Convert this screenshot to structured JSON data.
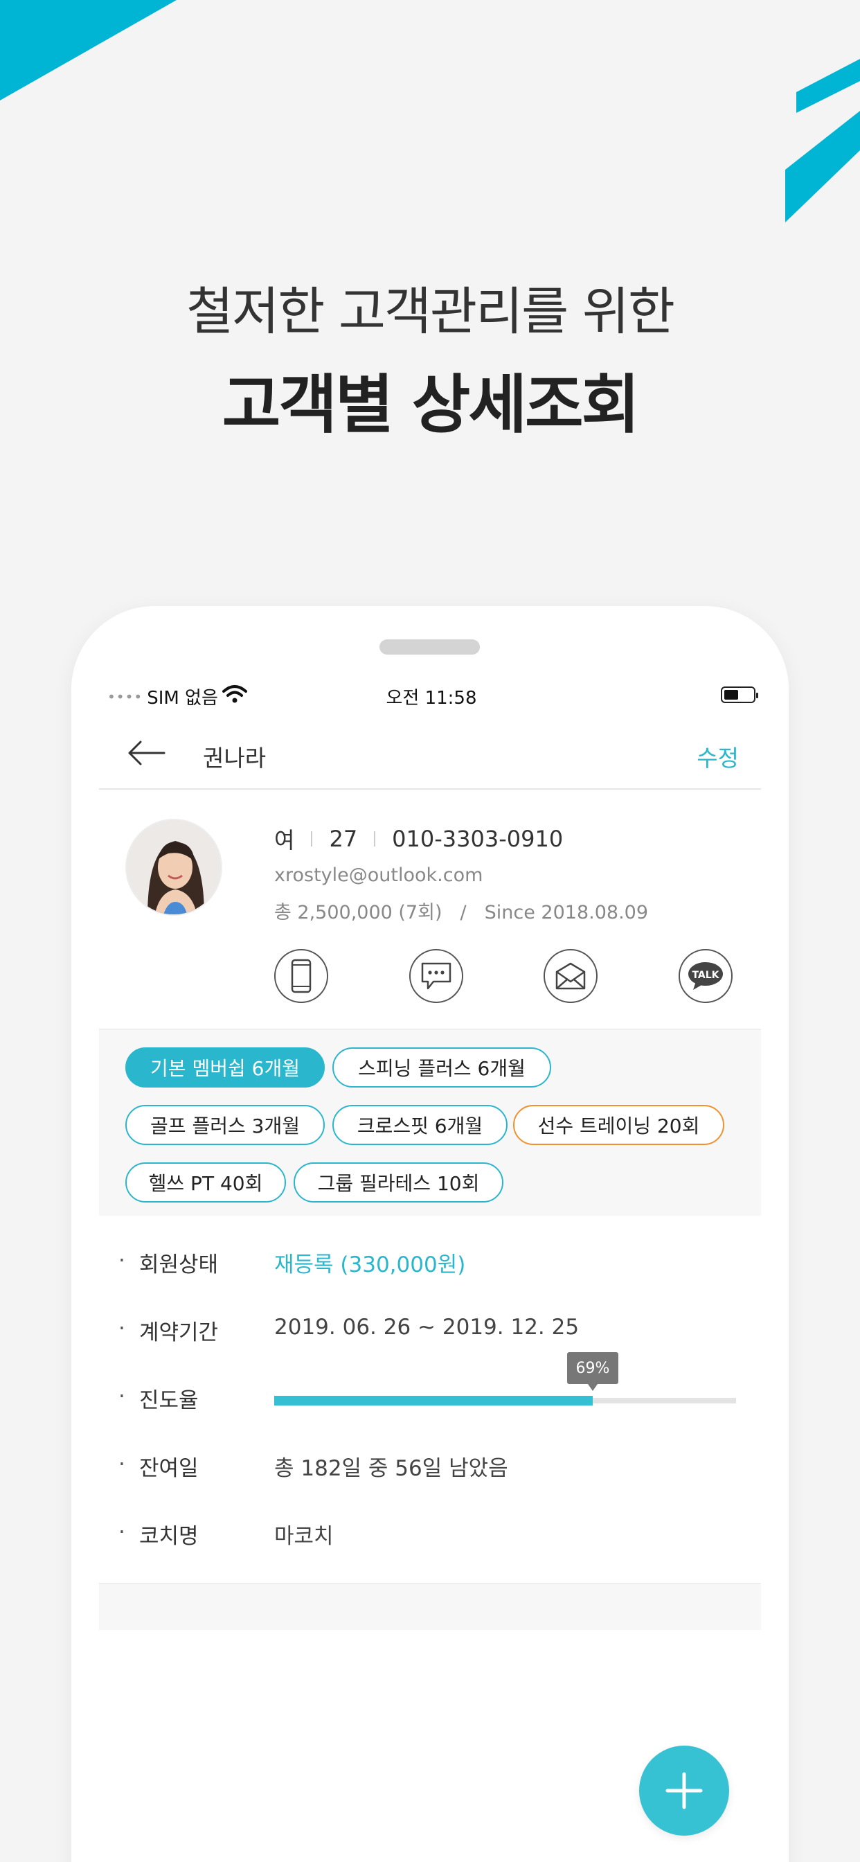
{
  "headline": {
    "subtitle": "철저한 고객관리를 위한",
    "title": "고객별 상세조회"
  },
  "status_bar": {
    "carrier": "SIM 없음",
    "time": "오전 11:58"
  },
  "nav": {
    "title": "권나라",
    "edit_label": "수정"
  },
  "profile": {
    "gender": "여",
    "age": "27",
    "phone": "010-3303-0910",
    "email": "xrostyle@outlook.com",
    "total": "총 2,500,000 (7회)",
    "slash": "/",
    "since": "Since 2018.08.09",
    "talk_label": "TALK"
  },
  "tags": [
    {
      "label": "기본 멤버쉽 6개월",
      "style": "active"
    },
    {
      "label": "스피닝 플러스 6개월",
      "style": "normal"
    },
    {
      "label": "골프 플러스 3개월",
      "style": "normal"
    },
    {
      "label": "크로스핏 6개월",
      "style": "normal"
    },
    {
      "label": "선수 트레이닝 20회",
      "style": "orange"
    },
    {
      "label": "헬쓰 PT 40회",
      "style": "normal"
    },
    {
      "label": "그룹 필라테스 10회",
      "style": "normal"
    }
  ],
  "details": {
    "bullet": "·",
    "status": {
      "label": "회원상태",
      "value": "재등록 (330,000원)"
    },
    "period": {
      "label": "계약기간",
      "value": "2019. 06. 26 ~ 2019. 12. 25"
    },
    "progress": {
      "label": "진도율",
      "value_label": "69%",
      "value": 0.69
    },
    "remaining": {
      "label": "잔여일",
      "value": "총 182일 중 56일 남았음"
    },
    "coach": {
      "label": "코치명",
      "value": "마코치"
    }
  },
  "colors": {
    "accent": "#2ab6cc",
    "tag_orange": "#f0912d",
    "decoration": "#00b4d3",
    "fab": "#36c2d3"
  },
  "icons": [
    "back-arrow-icon",
    "phone-icon",
    "message-icon",
    "mail-icon",
    "kakao-talk-icon",
    "plus-icon",
    "wifi-icon",
    "battery-icon"
  ]
}
